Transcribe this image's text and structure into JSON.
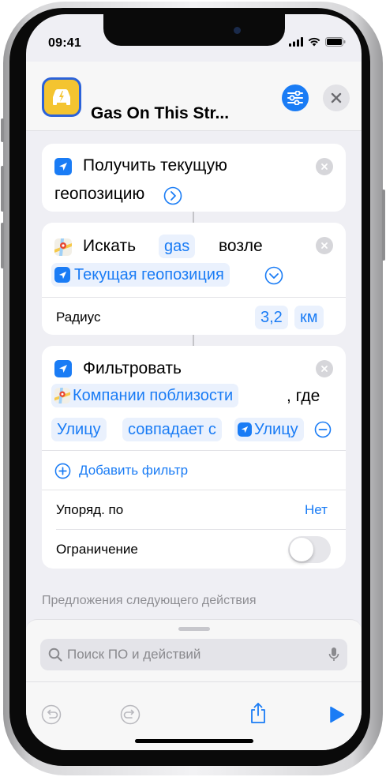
{
  "status": {
    "time": "09:41"
  },
  "header": {
    "title": "Gas On This Str..."
  },
  "actions": {
    "location": {
      "label_line1": "Получить текущую",
      "label_line2": "геопозицию"
    },
    "search": {
      "verb": "Искать",
      "query": "gas",
      "near": "возле",
      "location_token": "Текущая геопозиция",
      "radius_label": "Радиус",
      "radius_value": "3,2",
      "radius_unit": "км"
    },
    "filter": {
      "verb": "Фильтровать",
      "source_token": "Компании поблизости",
      "where": ", где",
      "field_token": "Улицу",
      "operator_token": "совпадает с",
      "value_token": "Улицу",
      "add_filter": "Добавить фильтр",
      "sort_label": "Упоряд. по",
      "sort_value": "Нет",
      "limit_label": "Ограничение",
      "limit_enabled": false
    }
  },
  "suggestions_header": "Предложения следующего действия",
  "search": {
    "placeholder": "Поиск ПО и действий"
  },
  "colors": {
    "accent": "#1a7cf5",
    "app_icon": "#f4c430"
  }
}
